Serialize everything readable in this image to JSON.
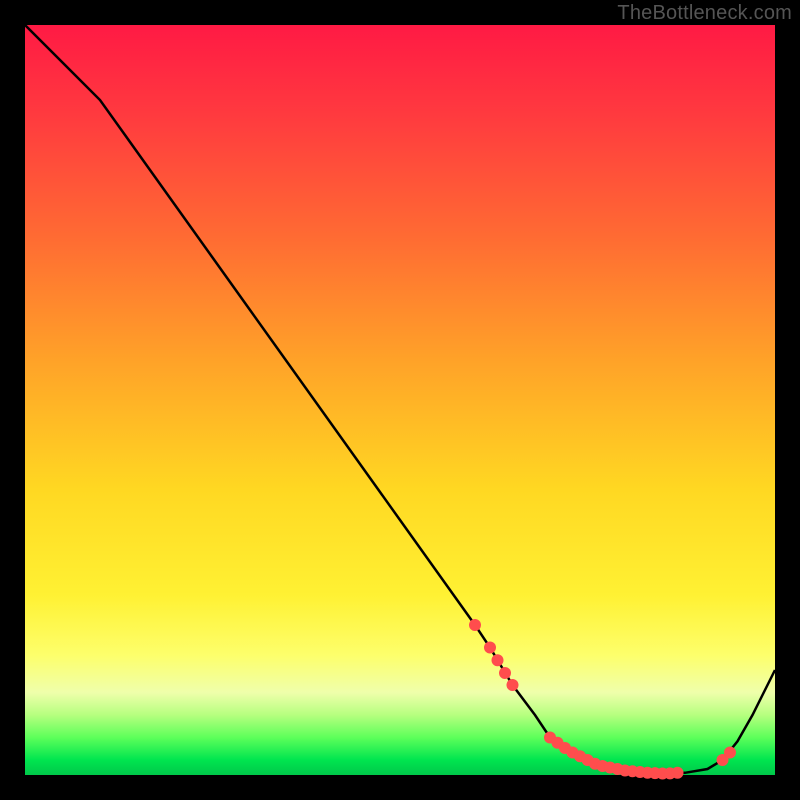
{
  "attribution": "TheBottleneck.com",
  "chart_data": {
    "type": "line",
    "title": "",
    "xlabel": "",
    "ylabel": "",
    "ylim": [
      0,
      100
    ],
    "xlim": [
      0,
      100
    ],
    "x": [
      0,
      5,
      10,
      15,
      20,
      25,
      30,
      35,
      40,
      45,
      50,
      55,
      60,
      62,
      65,
      68,
      70,
      73,
      76,
      79,
      82,
      85,
      88,
      91,
      93,
      95,
      97,
      100
    ],
    "values": [
      100,
      95,
      90,
      83,
      76,
      69,
      62,
      55,
      48,
      41,
      34,
      27,
      20,
      17,
      12,
      8,
      5,
      3,
      1.5,
      0.8,
      0.4,
      0.2,
      0.3,
      0.8,
      2.0,
      4.5,
      8.0,
      14
    ],
    "markers_x": [
      60,
      62,
      63,
      64,
      65,
      70,
      71,
      72,
      73,
      74,
      75,
      76,
      77,
      78,
      79,
      80,
      81,
      82,
      83,
      84,
      85,
      86,
      87,
      93,
      94
    ],
    "markers_y": [
      20,
      17,
      15.3,
      13.6,
      12,
      5,
      4.3,
      3.6,
      3,
      2.5,
      2.0,
      1.5,
      1.2,
      1.0,
      0.8,
      0.6,
      0.5,
      0.4,
      0.3,
      0.25,
      0.2,
      0.22,
      0.3,
      2.0,
      3.0
    ],
    "marker_color": "#ff4d4d",
    "line_color": "#000000"
  }
}
